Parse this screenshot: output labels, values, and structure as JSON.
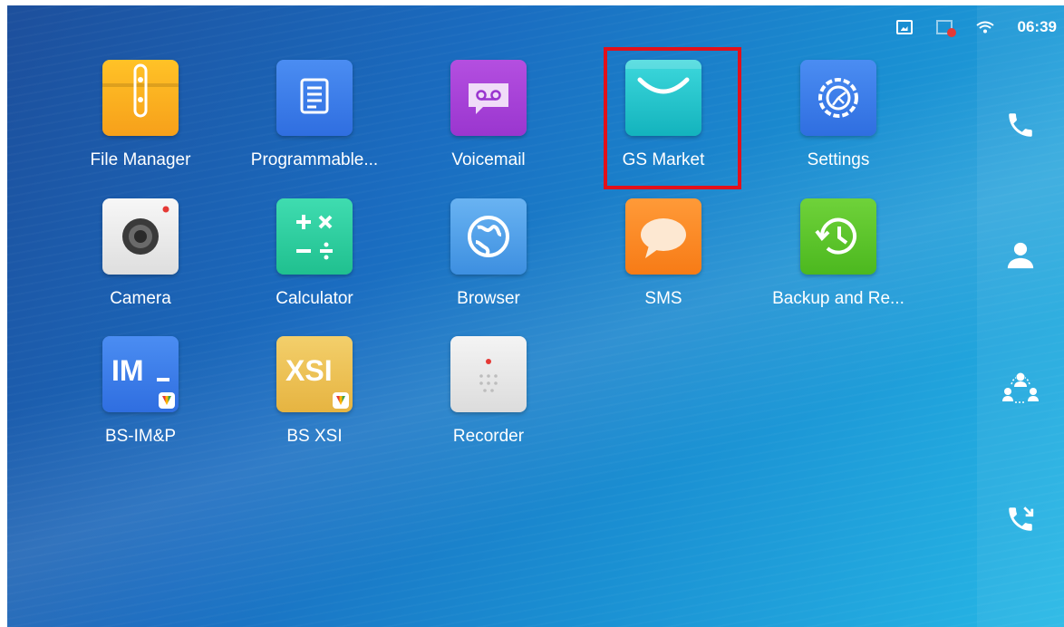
{
  "status_bar": {
    "time": "06:39",
    "icons": [
      "screenshot-icon",
      "network-error-icon",
      "wifi-icon"
    ]
  },
  "apps": [
    {
      "label": "File Manager",
      "icon": "file-manager-icon"
    },
    {
      "label": "Programmable...",
      "icon": "programmable-keys-icon"
    },
    {
      "label": "Voicemail",
      "icon": "voicemail-icon"
    },
    {
      "label": "GS Market",
      "icon": "gs-market-icon",
      "highlighted": true
    },
    {
      "label": "Settings",
      "icon": "settings-icon"
    },
    {
      "label": "Camera",
      "icon": "camera-icon"
    },
    {
      "label": "Calculator",
      "icon": "calculator-icon"
    },
    {
      "label": "Browser",
      "icon": "browser-icon"
    },
    {
      "label": "SMS",
      "icon": "sms-icon"
    },
    {
      "label": "Backup and Re...",
      "icon": "backup-restore-icon"
    },
    {
      "label": "BS-IM&P",
      "icon": "bs-imp-icon",
      "tile_text": "IM"
    },
    {
      "label": "BS XSI",
      "icon": "bs-xsi-icon",
      "tile_text": "XSI"
    },
    {
      "label": "Recorder",
      "icon": "recorder-icon"
    }
  ],
  "dock": [
    {
      "icon": "phone-icon"
    },
    {
      "icon": "contacts-icon"
    },
    {
      "icon": "conference-icon"
    },
    {
      "icon": "call-history-icon"
    }
  ],
  "colors": {
    "highlight": "#e3101a",
    "accent": "#1a8fd2"
  }
}
